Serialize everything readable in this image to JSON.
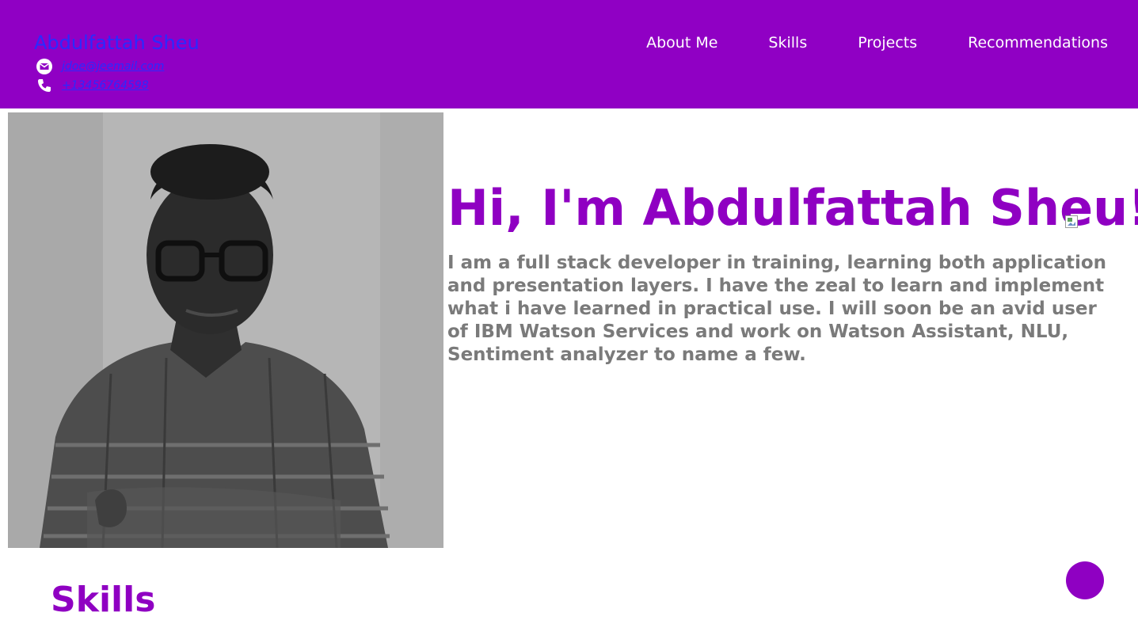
{
  "header": {
    "name": "Abdulfattah Sheu",
    "email": "jdoe@jeemail.com",
    "phone": "+13456764598",
    "nav": [
      "About Me",
      "Skills",
      "Projects",
      "Recommendations"
    ]
  },
  "hero": {
    "title": "Hi, I'm Abdulfattah Sheu!",
    "bio": "I am a full stack developer in training, learning both application and presentation layers. I have the zeal to learn and implement what i have learned in practical use. I will soon be an avid user of IBM Watson Services and work on Watson Assistant, NLU, Sentiment analyzer to name a few."
  },
  "sections": {
    "skills_heading": "Skills"
  },
  "icons": {
    "email": "email-icon",
    "phone": "phone-icon",
    "profile_photo": "profile-photo"
  },
  "colors": {
    "header_bg": "#9000c4",
    "accent": "#8f00c2",
    "link": "#2a2aff",
    "bio_text": "#7a7a7a"
  }
}
